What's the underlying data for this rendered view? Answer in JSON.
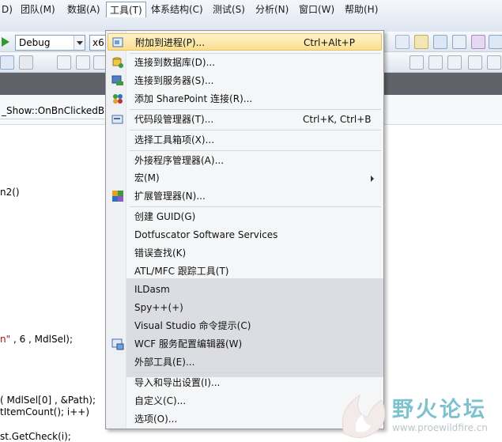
{
  "menubar": {
    "items": [
      {
        "label": "D)"
      },
      {
        "label": "团队(M)"
      },
      {
        "label": "数据(A)"
      },
      {
        "label": "工具(T)"
      },
      {
        "label": "体系结构(C)"
      },
      {
        "label": "测试(S)"
      },
      {
        "label": "分析(N)"
      },
      {
        "label": "窗口(W)"
      },
      {
        "label": "帮助(H)"
      }
    ]
  },
  "toolbar": {
    "config_value": "Debug",
    "platform_value": "x6"
  },
  "nav": {
    "function_text": "_Show::OnBnClickedBut"
  },
  "code": {
    "l1": "n2()",
    "l2_str": "n\"",
    "l2_rest": " , 6 , MdlSel);",
    "l3": "( MdlSel[0] , &Path);",
    "l4": "tItemCount(); i++)",
    "l5": "st.GetCheck(i);"
  },
  "tools_menu": {
    "items": [
      {
        "label": "附加到进程(P)...",
        "shortcut": "Ctrl+Alt+P"
      },
      {
        "label": "连接到数据库(D)..."
      },
      {
        "label": "连接到服务器(S)..."
      },
      {
        "label": "添加 SharePoint 连接(R)..."
      },
      {
        "label": "代码段管理器(T)...",
        "shortcut": "Ctrl+K, Ctrl+B"
      },
      {
        "label": "选择工具箱项(X)..."
      },
      {
        "label": "外接程序管理器(A)..."
      },
      {
        "label": "宏(M)"
      },
      {
        "label": "扩展管理器(N)..."
      },
      {
        "label": "创建 GUID(G)"
      },
      {
        "label": "Dotfuscator Software Services"
      },
      {
        "label": "错误查找(K)"
      },
      {
        "label": "ATL/MFC 跟踪工具(T)"
      },
      {
        "label": "ILDasm"
      },
      {
        "label": "Spy++(+)"
      },
      {
        "label": "Visual Studio 命令提示(C)"
      },
      {
        "label": "WCF 服务配置编辑器(W)"
      },
      {
        "label": "外部工具(E)..."
      },
      {
        "label": "导入和导出设置(I)..."
      },
      {
        "label": "自定义(C)..."
      },
      {
        "label": "选项(O)..."
      }
    ]
  },
  "watermark": {
    "text": "野火论坛",
    "url": "www.proewildfire.cn"
  }
}
